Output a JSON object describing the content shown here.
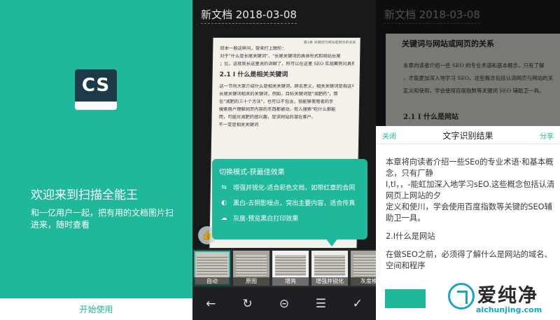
{
  "welcome": {
    "logo_text": "CS",
    "title": "欢迎来到扫描全能王",
    "description": "和一亿用户一起，把有用的文档图片扫进来，随时查看",
    "start_button": "开始使用"
  },
  "scanner": {
    "doc_title": "新文档 2018-03-08",
    "page_number": "第1章  关键词与网站或网页的关系",
    "page_lines": [
      "班本一般这样问，营来打上联阶：",
      "对于\"什么是长尾关键词\"、\"长尾关键词的具体形式和网站长尾",
      "；比，这就就长这里说的讲解了，所可以在这里 SEO 实战案例对具有较说去。"
    ],
    "page_heading": "2.1 I    什么是相关关键词",
    "page_lines2": [
      "这一节向大家介绍什么是相关关键词，顾名思义，相关关键词是指这与目标关键",
      "长尾关键词相关的关键词，例如，目标关键词是\"减肥药\"，那",
      "在\"减肥的三十个方法\"，也可以不包含，但能够使用者的手",
      "搜索用户理解网页内容的东西都被动。有入搜索\"吃什么都能",
      "而，可能对减肥药感兴趣，是该网站的潜在客户。",
      "不一定是相关关键词"
    ],
    "popup": {
      "heading": "切换模式-获最佳效果",
      "items": [
        {
          "icon": "enhance-icon",
          "text": "增强并锐化-适合彩色文档，如带红章的合同"
        },
        {
          "icon": "contrast-icon",
          "text": "黑白-去阴影噪点，突出主要内容，适合传真"
        },
        {
          "icon": "cloud-icon",
          "text": "灰度-预览黑白打印效果"
        }
      ]
    },
    "filters": [
      {
        "label": "自动",
        "selected": true
      },
      {
        "label": "原图",
        "selected": false
      },
      {
        "label": "增亮",
        "selected": false
      },
      {
        "label": "增强并锐化",
        "selected": false
      },
      {
        "label": "灰度模",
        "selected": false
      }
    ],
    "toolbar": {
      "back_icon": "←",
      "rotate_icon": "↻",
      "zoom_icon": "⊝",
      "adjust_icon": "☰",
      "confirm_icon": "✓"
    }
  },
  "ocr": {
    "doc_title": "新文档 2018-03-08",
    "page_heading": "关键词与网站或网页的关系",
    "page_lines": [
      "本章向读者介绍一些 SEO 的专业术语和基本概念，只有了解",
      "，才能更加深入地学习 SEO。这些概念包括认清网页与网站的关",
      "定义和使用，学会使用百度指数等关键词 SEO 辅助卫一具。"
    ],
    "page_subheading": "2.1 I    什么是网站",
    "header_close": "关闭",
    "header_title": "文字识别结果",
    "header_share": "分享",
    "result_paragraphs": [
      "本章将向读者介绍一些SEo的专业术语·和基本概念，只有厂静",
      "I,tl，，-能虹加深入地学习sEO.这些概念包括认清网页上网站的夕",
      "定义和使川，学会使用百度指数等关键的SEO辅助卫一具。",
      "2.I什么是网站",
      "在做SEO之前，必须得了解什么是网站的域名、空间和程序"
    ]
  },
  "watermark": {
    "brand": "爱纯净",
    "url": "aichunjing.com"
  },
  "colors": {
    "accent": "#1fb89a",
    "logo_dark": "#1d3a4b",
    "watermark_blue": "#1aa3c7"
  }
}
